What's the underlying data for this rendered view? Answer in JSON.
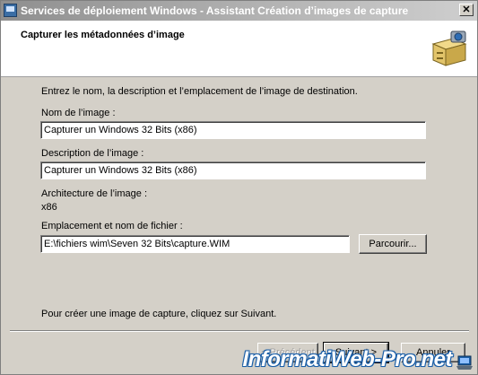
{
  "window": {
    "title": "Services de déploiement Windows - Assistant Création d’images de capture",
    "close_glyph": "✕"
  },
  "header": {
    "title": "Capturer les métadonnées d’image",
    "icon": "filing-cabinet-camera-icon"
  },
  "form": {
    "intro": "Entrez le nom, la description et l’emplacement de l’image de destination.",
    "name_label": "Nom de l’image :",
    "name_value": "Capturer un Windows 32 Bits (x86)",
    "description_label": "Description de l’image :",
    "description_value": "Capturer un Windows 32 Bits (x86)",
    "architecture_label": "Architecture de l’image :",
    "architecture_value": "x86",
    "location_label": "Emplacement et nom de fichier :",
    "location_value": "E:\\fichiers wim\\Seven 32 Bits\\capture.WIM",
    "browse_label": "Parcourir...",
    "footer_text": "Pour créer une image de capture, cliquez sur Suivant."
  },
  "buttons": {
    "previous": "< Précédent",
    "next": "Suivant >",
    "cancel": "Annuler"
  },
  "watermark": {
    "text": "InformatiWeb-Pro.net"
  }
}
